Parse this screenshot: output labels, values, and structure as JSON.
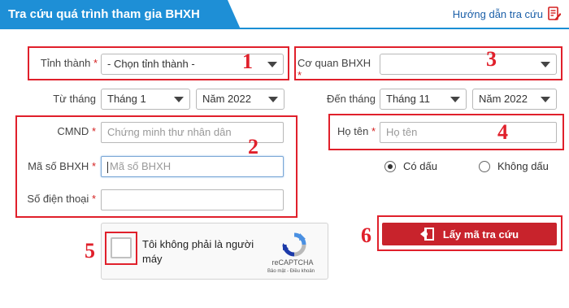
{
  "header": {
    "title": "Tra cứu quá trình tham gia BHXH",
    "guide_link": "Hướng dẫn tra cứu",
    "guide_icon": "edit-document-icon"
  },
  "form": {
    "required_mark": "*",
    "province": {
      "label": "Tỉnh thành",
      "value": "- Chọn tỉnh thành -"
    },
    "agency": {
      "label": "Cơ quan BHXH",
      "value": ""
    },
    "from": {
      "label": "Từ tháng",
      "month": "Tháng 1",
      "year": "Năm 2022"
    },
    "to": {
      "label": "Đến tháng",
      "month": "Tháng 11",
      "year": "Năm 2022"
    },
    "id_card": {
      "label": "CMND",
      "placeholder": "Chứng minh thư nhân dân"
    },
    "insurance_code": {
      "label": "Mã số BHXH",
      "placeholder": "Mã số BHXH"
    },
    "phone": {
      "label": "Số điện thoại",
      "placeholder": ""
    },
    "full_name": {
      "label": "Họ tên",
      "placeholder": "Họ tên"
    },
    "accent_options": [
      {
        "label": "Có dấu",
        "checked": true
      },
      {
        "label": "Không dấu",
        "checked": false
      }
    ]
  },
  "captcha": {
    "text": "Tôi không phải là người máy",
    "brand": "reCAPTCHA",
    "links": "Bảo mật - Điều khoản"
  },
  "submit": {
    "label": "Lấy mã tra cứu",
    "icon": "exit-door-icon"
  },
  "annotations": [
    "1",
    "2",
    "3",
    "4",
    "5",
    "6"
  ],
  "colors": {
    "header_blue": "#1e8fd6",
    "annotation_red": "#e0202b",
    "button_red": "#c8232c"
  }
}
